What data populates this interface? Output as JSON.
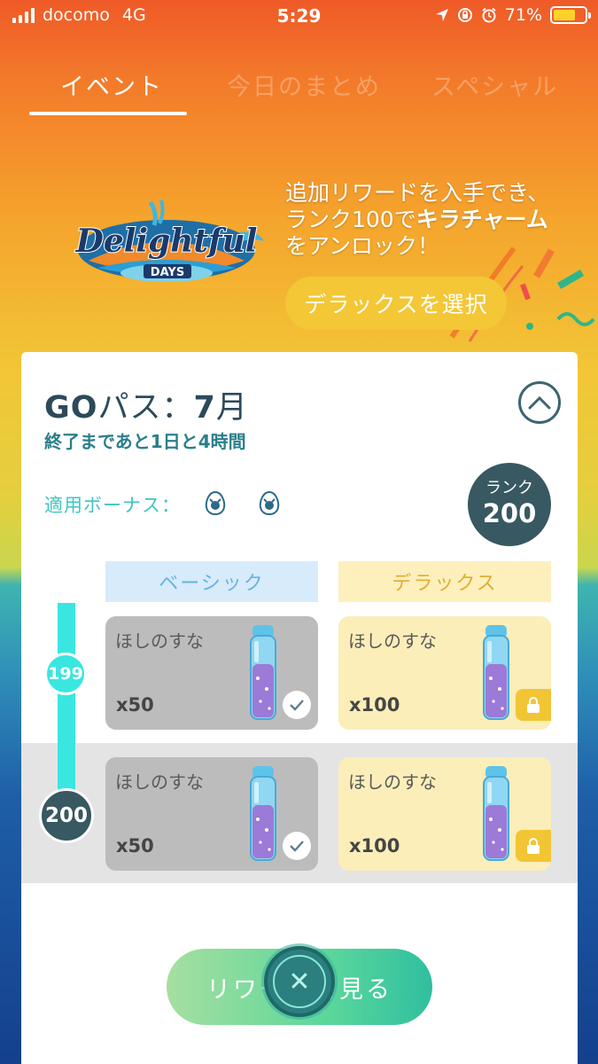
{
  "status_bar": {
    "carrier": "docomo",
    "network": "4G",
    "time": "5:29",
    "battery_percent": "71%",
    "battery_level": 0.71,
    "battery_color": "#ffd12a"
  },
  "tabs": [
    {
      "label": "イベント",
      "active": true
    },
    {
      "label": "今日のまとめ",
      "active": false
    },
    {
      "label": "スペシャル",
      "active": false
    }
  ],
  "banner": {
    "logo_text_main": "Delightful",
    "logo_text_sub": "DAYS",
    "line1": "追加リワードを入手でき、",
    "line2_prefix": "ランク100で",
    "line2_bold": "キラチャーム",
    "line3": "をアンロック！",
    "deluxe_button": "デラックスを選択"
  },
  "card": {
    "title_bold": "GO",
    "title_rest": "パス：",
    "title_month": "7",
    "title_month_suffix": "月",
    "time_remaining": "終了まであと1日と4時間",
    "bonus_label": "適用ボーナス：",
    "bonus_icons": [
      "egg-bonus-icon",
      "egg-bonus-icon"
    ],
    "rank_label": "ランク",
    "rank_value": "200",
    "columns": {
      "basic": "ベーシック",
      "deluxe": "デラックス"
    },
    "rows": [
      {
        "rank": "199",
        "basic": {
          "name": "ほしのすな",
          "qty": "x50",
          "claimed": true
        },
        "deluxe": {
          "name": "ほしのすな",
          "qty": "x100",
          "locked": true
        }
      },
      {
        "rank": "200",
        "basic": {
          "name": "ほしのすな",
          "qty": "x50",
          "claimed": true
        },
        "deluxe": {
          "name": "ほしのすな",
          "qty": "x100",
          "locked": true
        }
      }
    ],
    "view_rewards_button": "リワードを見る"
  },
  "colors": {
    "accent_teal": "#3ae6e0",
    "dark_teal": "#385862",
    "deluxe_yellow": "#f3c736"
  }
}
